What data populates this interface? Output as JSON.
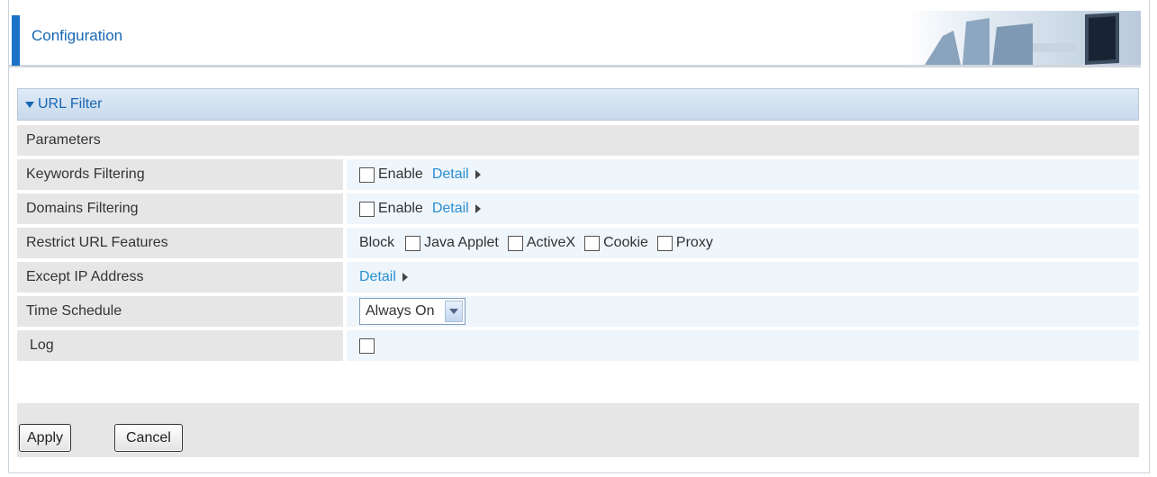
{
  "header": {
    "title": "Configuration"
  },
  "panel": {
    "title": "URL Filter"
  },
  "section": {
    "title": "Parameters"
  },
  "rows": {
    "keywords": {
      "label": "Keywords Filtering",
      "enable_label": "Enable",
      "enabled": false,
      "detail_label": "Detail"
    },
    "domains": {
      "label": "Domains Filtering",
      "enable_label": "Enable",
      "enabled": false,
      "detail_label": "Detail"
    },
    "restrict": {
      "label": "Restrict URL Features",
      "block_label": "Block",
      "options": [
        {
          "label": "Java Applet",
          "checked": false
        },
        {
          "label": "ActiveX",
          "checked": false
        },
        {
          "label": "Cookie",
          "checked": false
        },
        {
          "label": "Proxy",
          "checked": false
        }
      ]
    },
    "except_ip": {
      "label": "Except IP Address",
      "detail_label": "Detail"
    },
    "schedule": {
      "label": "Time Schedule",
      "selected": "Always On"
    },
    "log": {
      "label": "Log",
      "checked": false
    }
  },
  "buttons": {
    "apply": "Apply",
    "cancel": "Cancel"
  },
  "colors": {
    "accent": "#1a73c6",
    "link": "#2a8fd0",
    "label_bg": "#e6e6e6",
    "value_bg": "#eef5fb"
  },
  "icons": {
    "panel_toggle": "triangle-down-icon",
    "detail": "triangle-right-icon",
    "select": "chevron-down-icon"
  }
}
